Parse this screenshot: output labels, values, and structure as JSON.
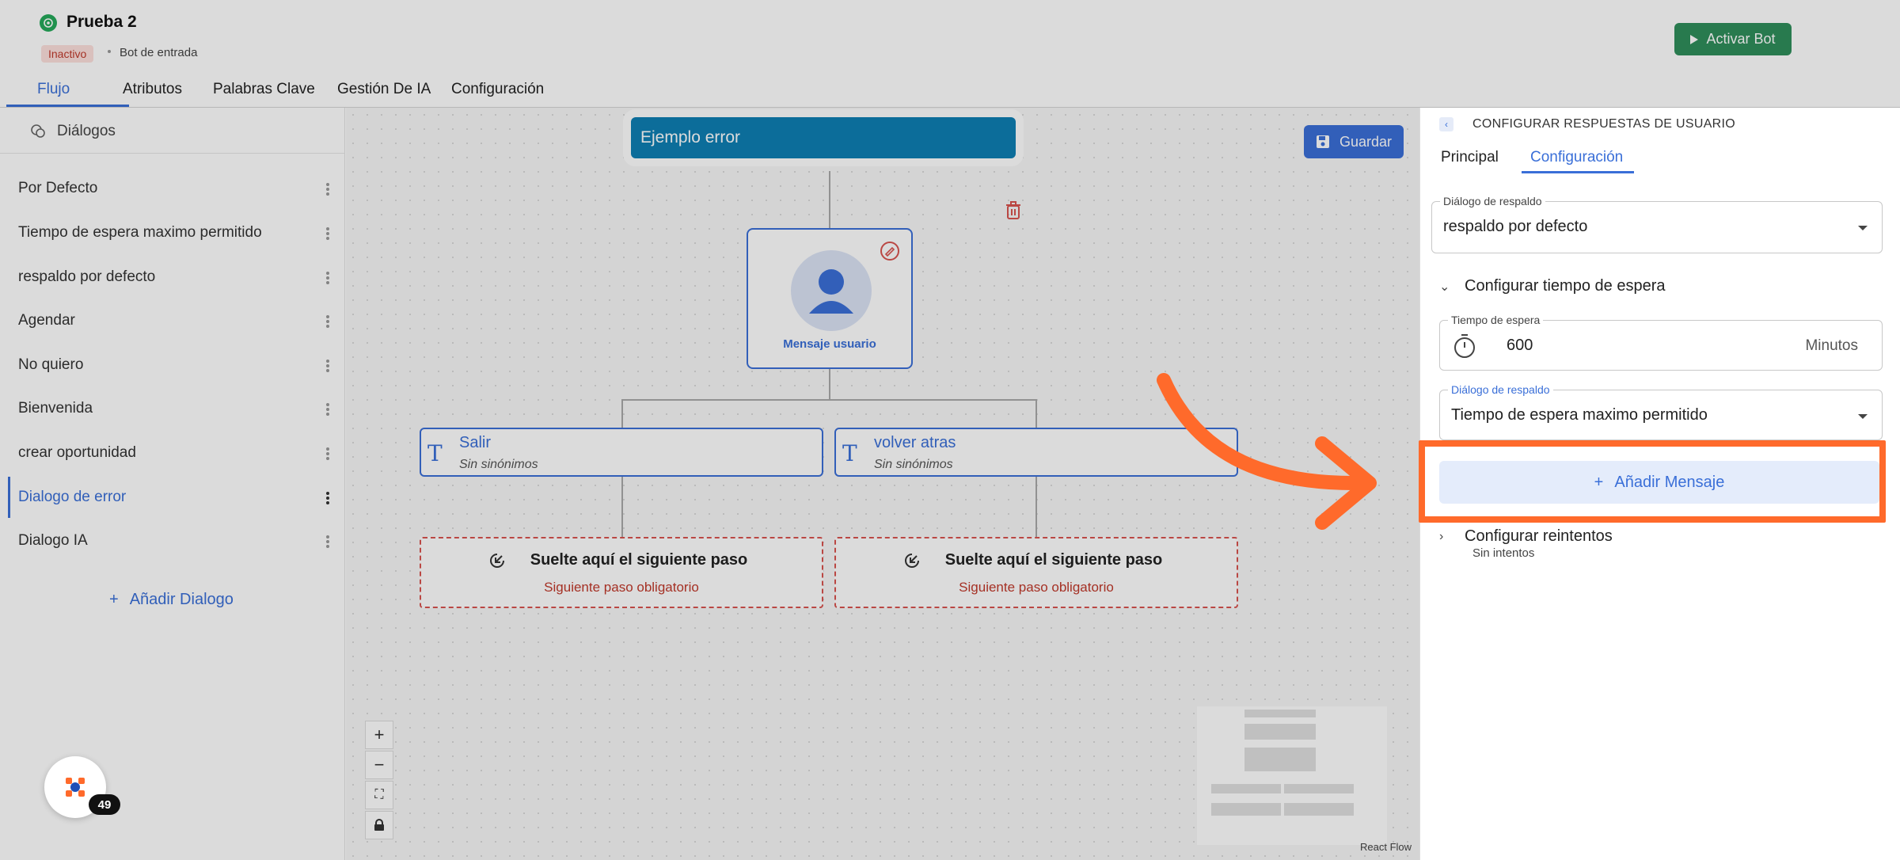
{
  "header": {
    "title": "Prueba 2",
    "status": "Inactivo",
    "subtitle": "Bot de entrada",
    "activate_label": "Activar Bot"
  },
  "tabs": [
    "Flujo",
    "Atributos",
    "Palabras Clave",
    "Gestión De IA",
    "Configuración"
  ],
  "sidebar": {
    "header": "Diálogos",
    "items": [
      {
        "label": "Por Defecto"
      },
      {
        "label": "Tiempo de espera maximo permitido"
      },
      {
        "label": "respaldo por defecto"
      },
      {
        "label": "Agendar"
      },
      {
        "label": "No quiero"
      },
      {
        "label": "Bienvenida"
      },
      {
        "label": "crear oportunidad"
      },
      {
        "label": "Dialogo de error"
      },
      {
        "label": "Dialogo IA"
      }
    ],
    "add_label": "Añadir Dialogo"
  },
  "canvas": {
    "title_node": "Ejemplo error",
    "save_label": "Guardar",
    "user_node_label": "Mensaje usuario",
    "options": [
      {
        "label": "Salir",
        "sub": "Sin sinónimos"
      },
      {
        "label": "volver atras",
        "sub": "Sin sinónimos"
      }
    ],
    "drop_title": "Suelte aquí el siguiente paso",
    "drop_sub": "Siguiente paso obligatorio",
    "attribution": "React Flow"
  },
  "panel": {
    "title": "CONFIGURAR RESPUESTAS DE USUARIO",
    "tabs": [
      "Principal",
      "Configuración"
    ],
    "fallback_legend": "Diálogo de respaldo",
    "fallback_value": "respaldo por defecto",
    "timeout_section": "Configurar tiempo de espera",
    "timeout_legend": "Tiempo de espera",
    "timeout_value": "600",
    "timeout_unit": "Minutos",
    "timeout_fallback_legend": "Diálogo de respaldo",
    "timeout_fallback_value": "Tiempo de espera maximo permitido",
    "add_message_label": "Añadir Mensaje",
    "retries_section": "Configurar reintentos",
    "retries_sub": "Sin intentos"
  },
  "fab": {
    "badge": "49"
  },
  "colors": {
    "accent": "#3a6fd8",
    "highlight": "#ff6a2b",
    "activate": "#2f8f5b",
    "title_node": "#0e7fb4"
  }
}
